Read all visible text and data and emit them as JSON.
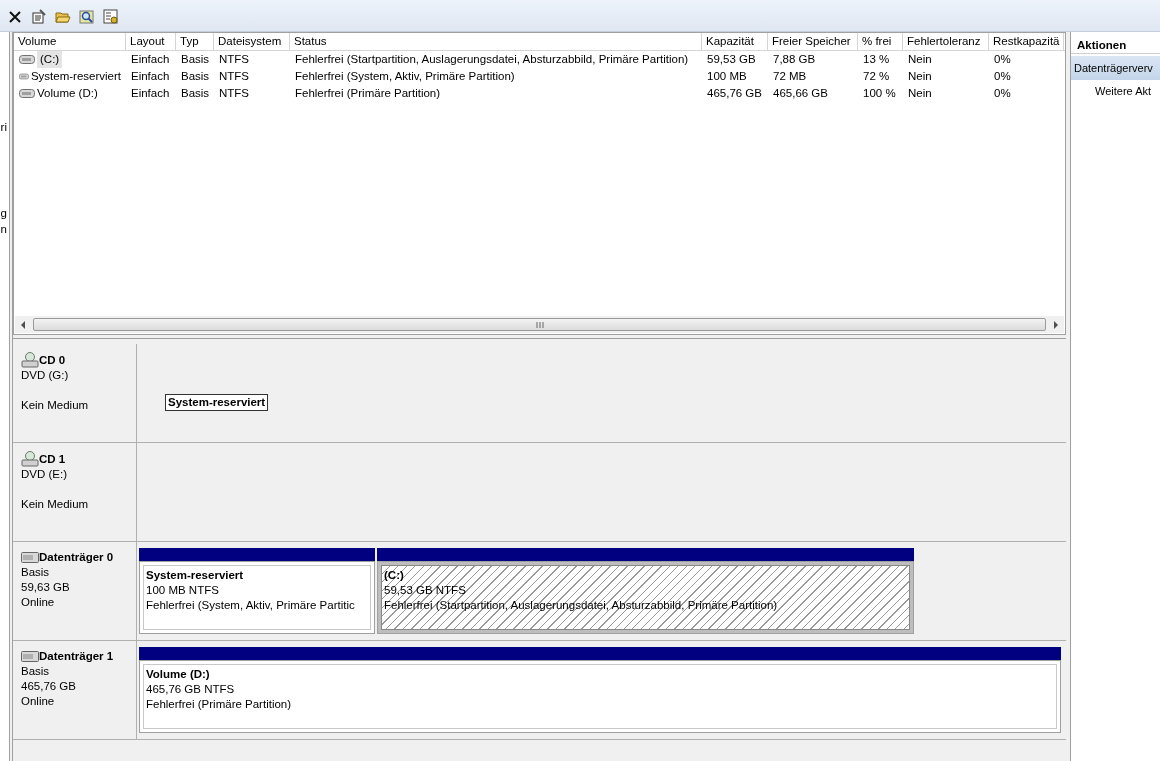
{
  "toolbar": {
    "buttons": [
      {
        "kind": "delete"
      },
      {
        "kind": "properties"
      },
      {
        "kind": "open"
      },
      {
        "kind": "search"
      },
      {
        "kind": "settings"
      }
    ]
  },
  "left_pane": {
    "fragments": [
      "ri",
      "g",
      "n"
    ]
  },
  "volume_table": {
    "columns": [
      "Volume",
      "Layout",
      "Typ",
      "Dateisystem",
      "Status",
      "Kapazität",
      "Freier Speicher",
      "% frei",
      "Fehlertoleranz",
      "Restkapazitä"
    ],
    "rows": [
      {
        "selected": true,
        "cells": [
          "(C:)",
          "Einfach",
          "Basis",
          "NTFS",
          "Fehlerfrei (Startpartition, Auslagerungsdatei, Absturzabbild, Primäre Partition)",
          "59,53 GB",
          "7,88 GB",
          "13 %",
          "Nein",
          "0%"
        ]
      },
      {
        "selected": false,
        "cells": [
          "System-reserviert",
          "Einfach",
          "Basis",
          "NTFS",
          "Fehlerfrei (System, Aktiv, Primäre Partition)",
          "100 MB",
          "72 MB",
          "72 %",
          "Nein",
          "0%"
        ]
      },
      {
        "selected": false,
        "cells": [
          "Volume (D:)",
          "Einfach",
          "Basis",
          "NTFS",
          "Fehlerfrei (Primäre Partition)",
          "465,76 GB",
          "465,66 GB",
          "100 %",
          "Nein",
          "0%"
        ]
      }
    ]
  },
  "disks": [
    {
      "kind": "cd",
      "name": "CD 0",
      "lines": [
        "DVD (G:)",
        "Kein Medium"
      ],
      "floating_label": "System-reserviert"
    },
    {
      "kind": "cd",
      "name": "CD 1",
      "lines": [
        "DVD (E:)",
        "Kein Medium"
      ]
    },
    {
      "kind": "disk",
      "name": "Datenträger 0",
      "lines": [
        "Basis",
        "59,63 GB",
        "Online"
      ],
      "partitions": [
        {
          "name": "System-reserviert",
          "size": "100 MB NTFS",
          "status": "Fehlerfrei (System, Aktiv, Primäre Partitic",
          "selected": false
        },
        {
          "name": "(C:)",
          "size": "59,53 GB NTFS",
          "status": "Fehlerfrei (Startpartition, Auslagerungsdatei, Absturzabbild, Primäre Partition)",
          "selected": true
        }
      ]
    },
    {
      "kind": "disk",
      "name": "Datenträger 1",
      "lines": [
        "Basis",
        "465,76 GB",
        "Online"
      ],
      "partitions": [
        {
          "name": "Volume  (D:)",
          "size": "465,76 GB NTFS",
          "status": "Fehlerfrei (Primäre Partition)",
          "selected": false
        }
      ]
    }
  ],
  "actions": {
    "title": "Aktionen",
    "items": [
      {
        "label": "Datenträgerverv",
        "selected": true
      },
      {
        "label": "Weitere Akt",
        "selected": false
      }
    ]
  }
}
